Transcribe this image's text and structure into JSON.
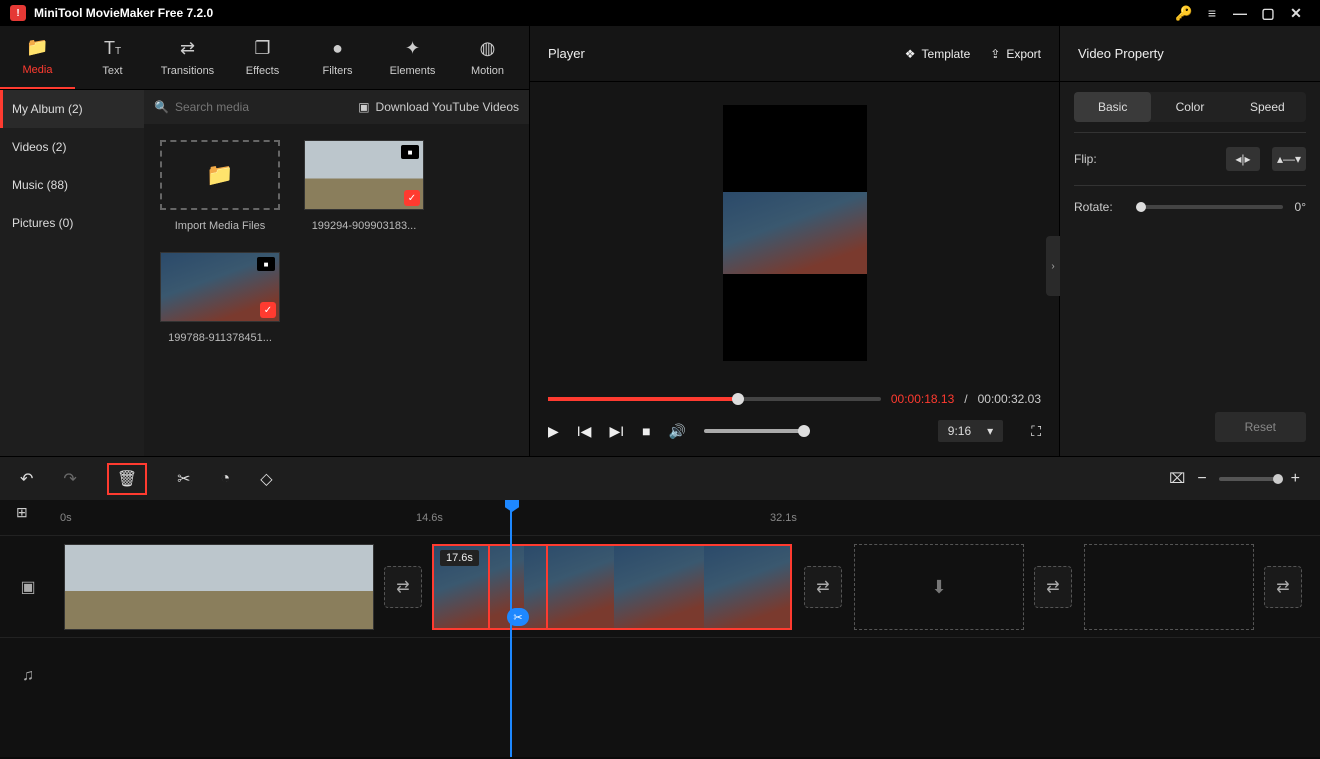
{
  "titlebar": {
    "app_title": "MiniTool MovieMaker Free 7.2.0"
  },
  "tabs": {
    "media": "Media",
    "text": "Text",
    "transitions": "Transitions",
    "effects": "Effects",
    "filters": "Filters",
    "elements": "Elements",
    "motion": "Motion"
  },
  "sidebar": {
    "my_album": "My Album (2)",
    "videos": "Videos (2)",
    "music": "Music (88)",
    "pictures": "Pictures (0)"
  },
  "search": {
    "placeholder": "Search media",
    "download": "Download YouTube Videos"
  },
  "thumbs": {
    "import": "Import Media Files",
    "clip1": "199294-909903183...",
    "clip2": "199788-911378451..."
  },
  "player": {
    "title": "Player",
    "template": "Template",
    "export": "Export",
    "time_current": "00:00:18.13",
    "time_sep": " / ",
    "time_total": "00:00:32.03",
    "aspect": "9:16"
  },
  "props": {
    "header": "Video Property",
    "tab_basic": "Basic",
    "tab_color": "Color",
    "tab_speed": "Speed",
    "flip": "Flip:",
    "rotate": "Rotate:",
    "rotate_value": "0°",
    "reset": "Reset"
  },
  "timeline": {
    "t0": "0s",
    "t1": "14.6s",
    "t2": "32.1s",
    "clip_dur": "17.6s"
  }
}
